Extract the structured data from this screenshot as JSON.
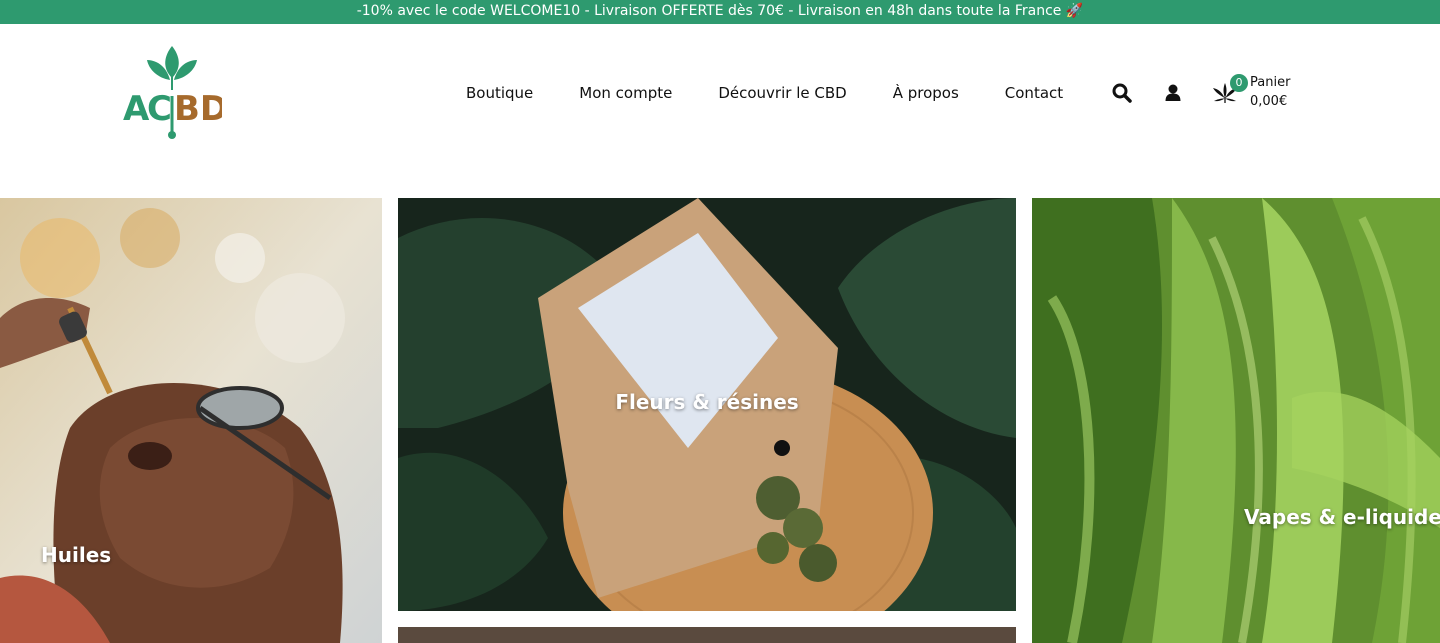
{
  "promo": {
    "text": "-10% avec le code WELCOME10 - Livraison OFFERTE dès 70€ - Livraison en 48h dans toute la France 🚀"
  },
  "brand": {
    "name": "ACBD",
    "colors": {
      "green": "#2e9a6f",
      "brown": "#a66a2c"
    }
  },
  "nav": {
    "items": [
      {
        "label": "Boutique"
      },
      {
        "label": "Mon compte"
      },
      {
        "label": "Découvrir le CBD"
      },
      {
        "label": "À propos"
      },
      {
        "label": "Contact"
      }
    ]
  },
  "icons": {
    "search": "search-icon",
    "account": "user-icon",
    "cart": "cannabis-leaf-icon"
  },
  "cart": {
    "count": "0",
    "label": "Panier",
    "total": "0,00€"
  },
  "categories": [
    {
      "label": "Huiles"
    },
    {
      "label": "Fleurs & résines"
    },
    {
      "label": "Vapes & e-liquides"
    }
  ]
}
